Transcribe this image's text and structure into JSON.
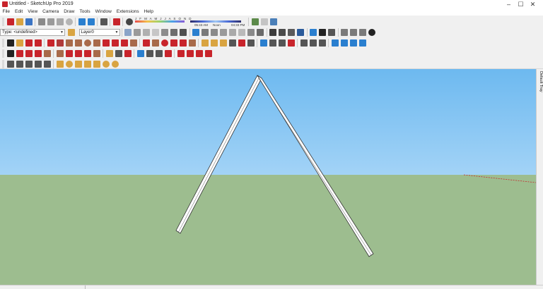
{
  "window": {
    "title": "Untitled - SketchUp Pro 2019",
    "controls": [
      "–",
      "☐",
      "✕"
    ]
  },
  "menu": [
    "File",
    "Edit",
    "View",
    "Camera",
    "Draw",
    "Tools",
    "Window",
    "Extensions",
    "Help"
  ],
  "shadows": {
    "months": "J F M A M J J A S O N D",
    "time_start": "05:43 AM",
    "time_mid": "Noon",
    "time_end": "04:33 PM"
  },
  "entity_info": {
    "type_label": "Type: <undefined>",
    "layer_label": "Layer0"
  },
  "tray": {
    "label": "Default Tray"
  },
  "colors": {
    "sky_top": "#6db9f0",
    "sky_bottom": "#d4ebfb",
    "ground": "#9dbd8f",
    "accent_red": "#c8242b",
    "accent_blue": "#2a7fcf"
  }
}
